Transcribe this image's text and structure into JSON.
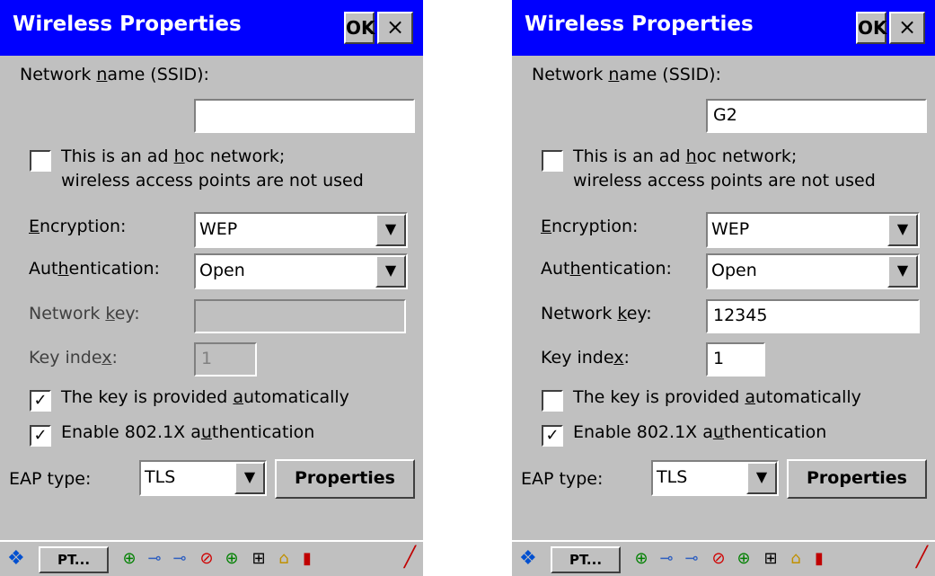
{
  "screens": [
    {
      "title": "Wireless Properties",
      "ok_label": "OK",
      "close_label": "×",
      "ssid_label_a": "Network ",
      "ssid_label_u": "n",
      "ssid_label_b": "ame (SSID):",
      "ssid_value": "",
      "adhoc_line1_a": "This is an ad ",
      "adhoc_line1_u": "h",
      "adhoc_line1_b": "oc network;",
      "adhoc_line2": "wireless access points are not used",
      "adhoc_checked": "",
      "enc_label_u": "E",
      "enc_label_b": "ncryption:",
      "enc_value": "WEP",
      "auth_label_a": "Aut",
      "auth_label_u": "h",
      "auth_label_b": "entication:",
      "auth_value": "Open",
      "netkey_label_a": "Network ",
      "netkey_label_u": "k",
      "netkey_label_b": "ey:",
      "netkey_value": "",
      "keyidx_label_a": "Key inde",
      "keyidx_label_u": "x",
      "keyidx_label_b": ":",
      "keyidx_value": "1",
      "auto_label_a": "The key is provided ",
      "auto_label_u": "a",
      "auto_label_b": "utomatically",
      "auto_checked": "✓",
      "dot1x_label_a": "Enable 802.1X a",
      "dot1x_label_u": "u",
      "dot1x_label_b": "thentication",
      "dot1x_checked": "✓",
      "eap_label": "EAP type:",
      "eap_value": "TLS",
      "properties_label": "Properties",
      "taskbar_task": "PT..."
    },
    {
      "title": "Wireless Properties",
      "ok_label": "OK",
      "close_label": "×",
      "ssid_label_a": "Network ",
      "ssid_label_u": "n",
      "ssid_label_b": "ame (SSID):",
      "ssid_value": "G2",
      "adhoc_line1_a": "This is an ad ",
      "adhoc_line1_u": "h",
      "adhoc_line1_b": "oc network;",
      "adhoc_line2": "wireless access points are not used",
      "adhoc_checked": "",
      "enc_label_u": "E",
      "enc_label_b": "ncryption:",
      "enc_value": "WEP",
      "auth_label_a": "Aut",
      "auth_label_u": "h",
      "auth_label_b": "entication:",
      "auth_value": "Open",
      "netkey_label_a": "Network ",
      "netkey_label_u": "k",
      "netkey_label_b": "ey:",
      "netkey_value": "12345",
      "keyidx_label_a": "Key inde",
      "keyidx_label_u": "x",
      "keyidx_label_b": ":",
      "keyidx_value": "1",
      "auto_label_a": "The key is provided ",
      "auto_label_u": "a",
      "auto_label_b": "utomatically",
      "auto_checked": "",
      "dot1x_label_a": "Enable 802.1X a",
      "dot1x_label_u": "u",
      "dot1x_label_b": "thentication",
      "dot1x_checked": "✓",
      "eap_label": "EAP type:",
      "eap_value": "TLS",
      "properties_label": "Properties",
      "taskbar_task": "PT..."
    }
  ],
  "icons": {
    "start": "windows-start-icon",
    "dropdown_arrow": "▼",
    "tray": [
      "network-globe-icon",
      "network-connection-icon",
      "network-connection-icon",
      "no-wireless-icon",
      "network-globe-icon",
      "device-icon",
      "lock-icon",
      "battery-icon"
    ],
    "pen": "stylus-pen-icon"
  },
  "colors": {
    "titlebar": "#0000ff",
    "window": "#c0c0c0",
    "field": "#ffffff"
  }
}
